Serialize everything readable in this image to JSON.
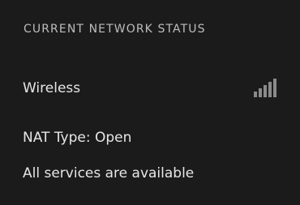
{
  "section": {
    "title": "CURRENT NETWORK STATUS"
  },
  "connection": {
    "type_label": "Wireless",
    "signal_icon": "signal-bars-icon",
    "signal_bars_total": 5,
    "signal_bars_active": 5,
    "signal_color": "#8a8a8a"
  },
  "nat": {
    "text": "NAT Type: Open"
  },
  "services": {
    "text": "All services are available"
  },
  "colors": {
    "background": "#1b1b1b",
    "text": "#e6e6e6",
    "heading": "#bdbdbd"
  }
}
